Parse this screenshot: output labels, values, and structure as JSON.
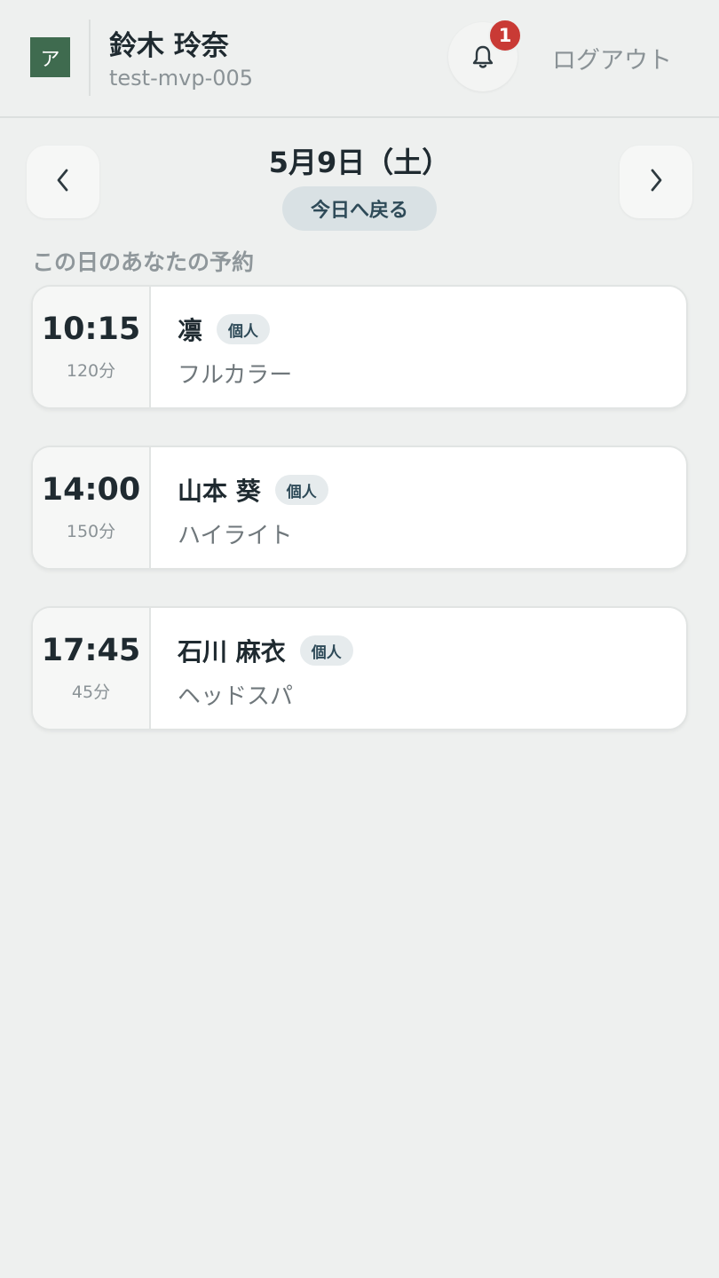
{
  "header": {
    "logo_char": "ア",
    "user_name": "鈴木 玲奈",
    "user_id": "test-mvp-005",
    "notification_count": "1",
    "logout_label": "ログアウト"
  },
  "date_nav": {
    "date_label": "5月9日（土）",
    "today_label": "今日へ戻る"
  },
  "section_title": "この日のあなたの予約",
  "appointments": [
    {
      "time": "10:15",
      "duration": "120分",
      "customer": "凛",
      "tag": "個人",
      "service": "フルカラー"
    },
    {
      "time": "14:00",
      "duration": "150分",
      "customer": "山本 葵",
      "tag": "個人",
      "service": "ハイライト"
    },
    {
      "time": "17:45",
      "duration": "45分",
      "customer": "石川 麻衣",
      "tag": "個人",
      "service": "ヘッドスパ"
    }
  ],
  "icons": {
    "notifications": "bell-icon",
    "previous_day": "chevron-left-icon",
    "next_day": "chevron-right-icon"
  },
  "colors": {
    "background": "#eef0ef",
    "logo": "#3f6b4f",
    "badge": "#c93a35",
    "card": "#ffffff",
    "tag_bg": "#e6ebed",
    "today_button_bg": "#d9e1e4"
  }
}
